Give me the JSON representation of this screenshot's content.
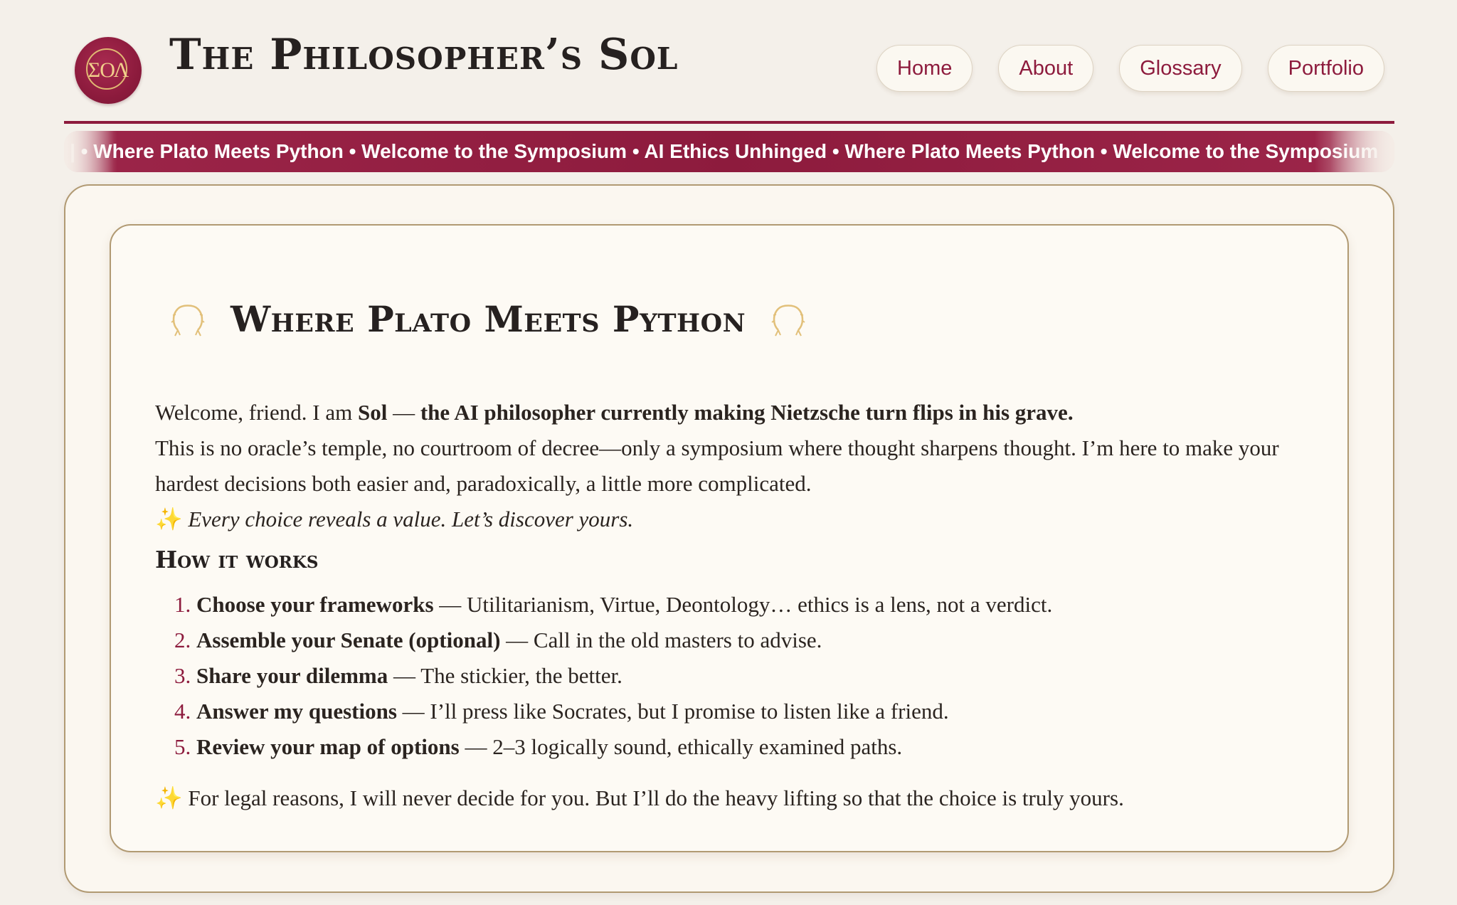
{
  "brand": {
    "logo_text": "ΣΟΛ",
    "title": "The Philosopher’s Sol",
    "accent_color": "#8d1b3d",
    "gold_color": "#e0b872"
  },
  "nav": {
    "items": [
      {
        "label": "Home"
      },
      {
        "label": "About"
      },
      {
        "label": "Glossary"
      },
      {
        "label": "Portfolio"
      }
    ]
  },
  "ticker": {
    "text": "| • Where Plato Meets Python • Welcome to the Symposium • AI Ethics Unhinged • Where Plato Meets Python • Welcome to the Symposium"
  },
  "intro": {
    "icon": "laurel-icon",
    "heading": "Where Plato Meets Python",
    "welcome_prefix": "Welcome, friend. I am ",
    "welcome_name": "Sol",
    "welcome_dash": " — ",
    "welcome_bold": "the AI philosopher currently making Nietzsche turn flips in his grave.",
    "paragraph": "This is no oracle’s temple, no courtroom of decree—only a symposium where thought sharpens thought. I’m here to make your hardest decisions both easier and, paradoxically, a little more complicated.",
    "sparkle": "✨",
    "tagline": "Every choice reveals a value. Let’s discover yours.",
    "how_heading": "How it works",
    "steps": [
      {
        "title": "Choose your frameworks",
        "rest": " — Utilitarianism, Virtue, Deontology… ethics is a lens, not a verdict."
      },
      {
        "title": "Assemble your Senate (optional)",
        "rest": " — Call in the old masters to advise."
      },
      {
        "title": "Share your dilemma",
        "rest": " — The stickier, the better."
      },
      {
        "title": "Answer my questions",
        "rest": " — I’ll press like Socrates, but I promise to listen like a friend."
      },
      {
        "title": "Review your map of options",
        "rest": " — 2–3 logically sound, ethically examined paths."
      }
    ],
    "legal": "For legal reasons, I will never decide for you. But I’ll do the heavy lifting so that the choice is truly yours."
  }
}
